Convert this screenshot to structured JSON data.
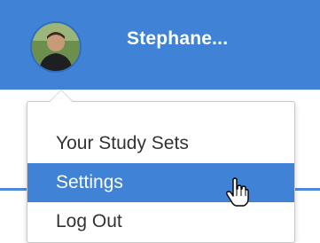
{
  "header": {
    "user_name": "Stephane...",
    "avatar_alt": "user avatar"
  },
  "dropdown": {
    "items": [
      {
        "label": "Your Study Sets",
        "active": false
      },
      {
        "label": "Settings",
        "active": true
      },
      {
        "label": "Log Out",
        "active": false
      }
    ]
  },
  "colors": {
    "brand_blue": "#3f82d6",
    "menu_text": "#333333",
    "menu_bg": "#ffffff"
  },
  "icons": {
    "cursor": "hand-pointer-icon"
  }
}
